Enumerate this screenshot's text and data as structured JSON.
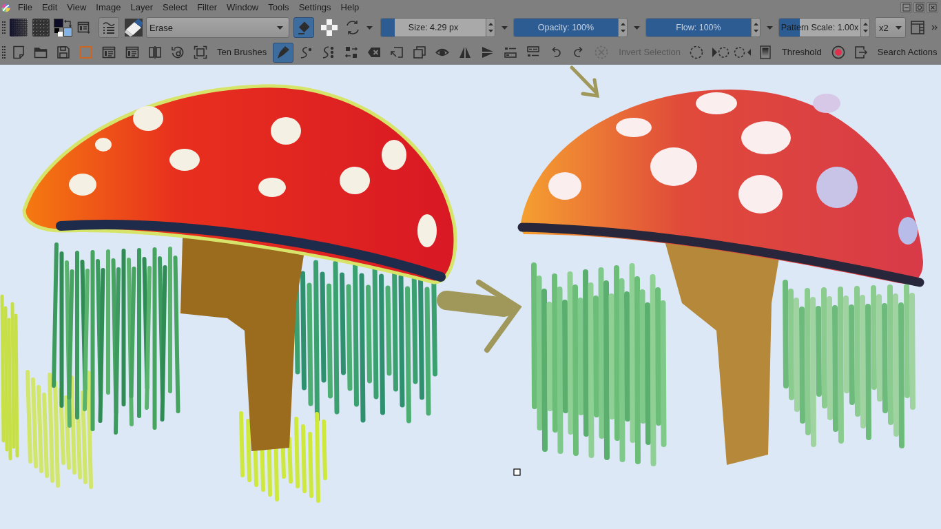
{
  "menu_bar": {
    "items": [
      "File",
      "Edit",
      "View",
      "Image",
      "Layer",
      "Select",
      "Filter",
      "Window",
      "Tools",
      "Settings",
      "Help"
    ]
  },
  "tool_options_bar": {
    "color_selector": {
      "foreground": {
        "color": "#0c0c26"
      },
      "background": {
        "color": "#82b4e8"
      }
    },
    "brush_preset": {
      "value": "Erase"
    },
    "eraser_mode": {
      "on": true
    },
    "sliders": [
      {
        "label": "Size: 4.29 px",
        "level": 0.13
      },
      {
        "label": "Opacity: 100%",
        "level": 1
      },
      {
        "label": "Flow: 100%",
        "level": 1
      },
      {
        "label": "Pattern Scale: 1.00x",
        "level": 0.25
      }
    ],
    "dropdown_2": {
      "value": "x2"
    }
  },
  "actions_toolbar": {
    "ten_brushes": {
      "label": "Ten Brushes"
    },
    "brush_tools": [
      {
        "kind": "freehand",
        "selected": true
      },
      {
        "kind": "dynamic",
        "selected": false
      },
      {
        "kind": "multi",
        "selected": false
      }
    ],
    "deselect": {
      "disabled": true
    },
    "invert_selection": {
      "label": "Invert Selection",
      "disabled": true
    },
    "threshold": {
      "label": "Threshold"
    },
    "search_actions": {
      "label": "Search Actions"
    }
  }
}
